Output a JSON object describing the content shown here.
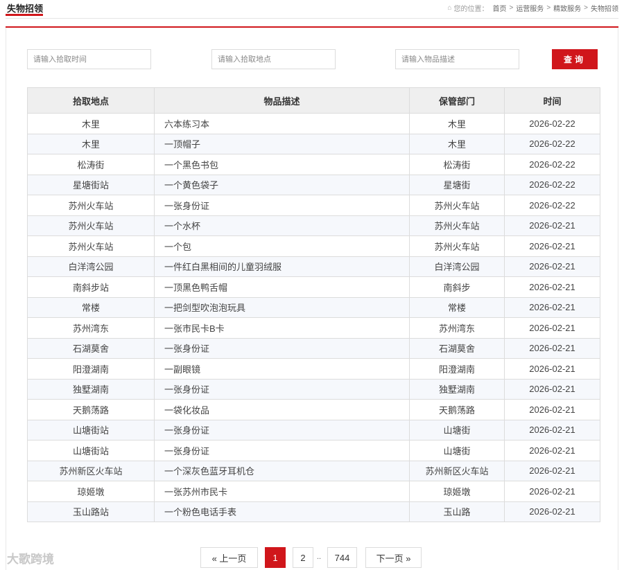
{
  "header": {
    "title": "失物招领",
    "breadcrumb": {
      "prefix": "您的位置：",
      "items": [
        "首页",
        "运营服务",
        "精致服务",
        "失物招领"
      ],
      "separator": ">"
    }
  },
  "search": {
    "time_placeholder": "请输入拾取时间",
    "location_placeholder": "请输入拾取地点",
    "description_placeholder": "请输入物品描述",
    "button_label": "查询"
  },
  "table": {
    "columns": [
      "拾取地点",
      "物品描述",
      "保管部门",
      "时间"
    ],
    "rows": [
      [
        "木里",
        "六本练习本",
        "木里",
        "2026-02-22"
      ],
      [
        "木里",
        "一顶帽子",
        "木里",
        "2026-02-22"
      ],
      [
        "松涛街",
        "一个黑色书包",
        "松涛街",
        "2026-02-22"
      ],
      [
        "星塘街站",
        "一个黄色袋子",
        "星塘街",
        "2026-02-22"
      ],
      [
        "苏州火车站",
        "一张身份证",
        "苏州火车站",
        "2026-02-22"
      ],
      [
        "苏州火车站",
        "一个水杯",
        "苏州火车站",
        "2026-02-21"
      ],
      [
        "苏州火车站",
        "一个包",
        "苏州火车站",
        "2026-02-21"
      ],
      [
        "白洋湾公园",
        "一件红白黑相间的儿童羽绒服",
        "白洋湾公园",
        "2026-02-21"
      ],
      [
        "南斜步站",
        "一顶黑色鸭舌帽",
        "南斜步",
        "2026-02-21"
      ],
      [
        "常楼",
        "一把剑型吹泡泡玩具",
        "常楼",
        "2026-02-21"
      ],
      [
        "苏州湾东",
        "一张市民卡B卡",
        "苏州湾东",
        "2026-02-21"
      ],
      [
        "石湖莫舍",
        "一张身份证",
        "石湖莫舍",
        "2026-02-21"
      ],
      [
        "阳澄湖南",
        "一副眼镜",
        "阳澄湖南",
        "2026-02-21"
      ],
      [
        "独墅湖南",
        "一张身份证",
        "独墅湖南",
        "2026-02-21"
      ],
      [
        "天鹅荡路",
        "一袋化妆品",
        "天鹅荡路",
        "2026-02-21"
      ],
      [
        "山塘街站",
        "一张身份证",
        "山塘街",
        "2026-02-21"
      ],
      [
        "山塘街站",
        "一张身份证",
        "山塘街",
        "2026-02-21"
      ],
      [
        "苏州新区火车站",
        "一个深灰色蓝牙耳机仓",
        "苏州新区火车站",
        "2026-02-21"
      ],
      [
        "琼姬墩",
        "一张苏州市民卡",
        "琼姬墩",
        "2026-02-21"
      ],
      [
        "玉山路站",
        "一个粉色电话手表",
        "玉山路",
        "2026-02-21"
      ]
    ]
  },
  "pagination": {
    "prev_label": "« 上一页",
    "pages": [
      "1",
      "2"
    ],
    "ellipsis": "..",
    "last_page": "744",
    "next_label": "下一页 »",
    "current": "1"
  },
  "watermark": "大歌跨境",
  "colors": {
    "accent": "#d0161b",
    "header_bg": "#efefef",
    "stripe": "#f6f8fc"
  }
}
